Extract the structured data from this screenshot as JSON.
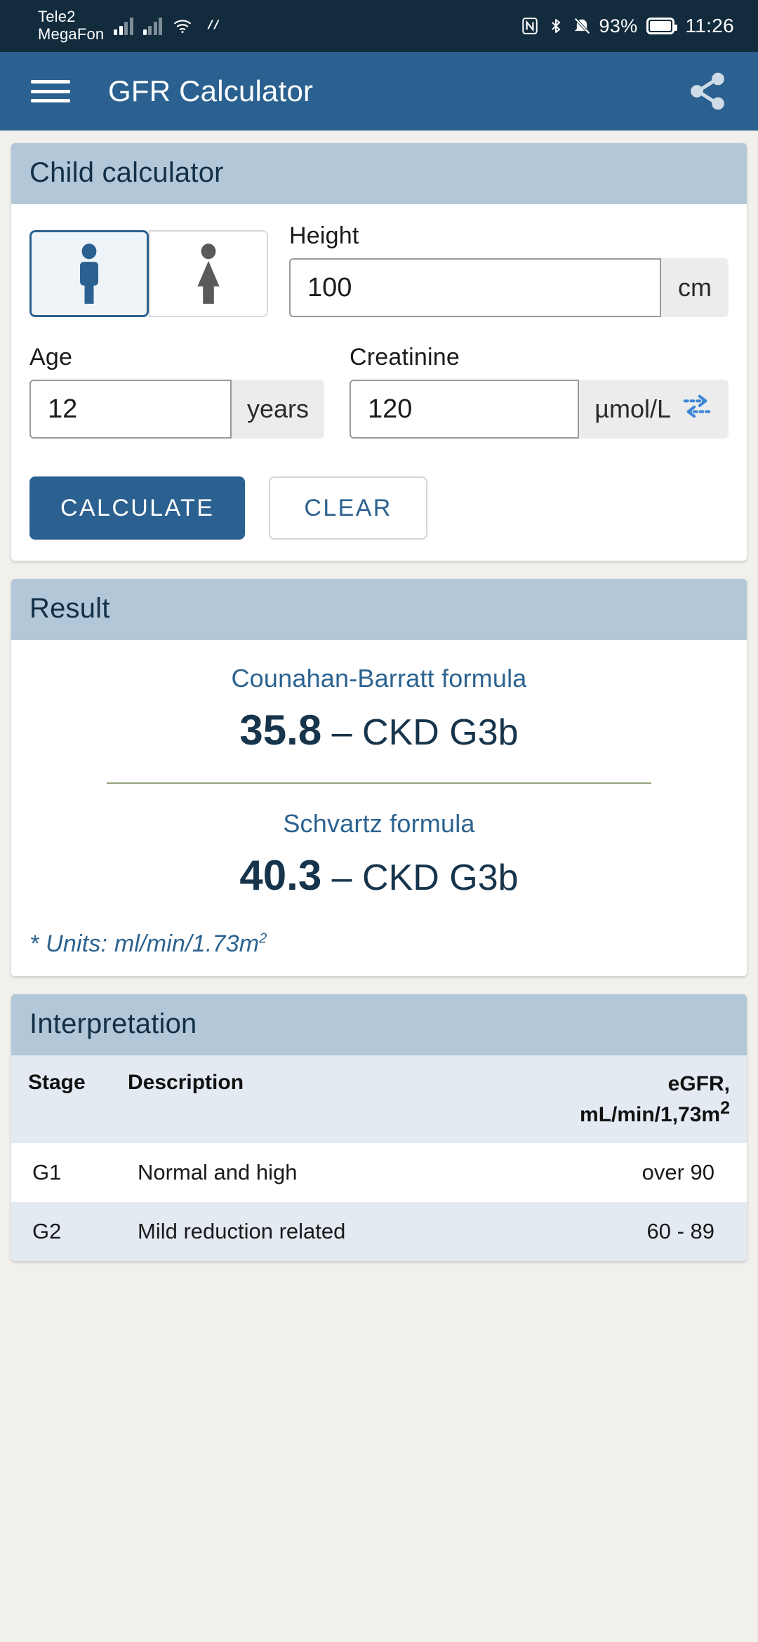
{
  "status_bar": {
    "carrier_1": "Tele2",
    "carrier_2": "MegaFon",
    "battery_percent": "93%",
    "clock": "11:26",
    "icons": [
      "signal-bars-icon",
      "signal-bars-icon",
      "wifi-icon",
      "data-transfer-icon",
      "nfc-icon",
      "bluetooth-icon",
      "mute-icon",
      "battery-icon"
    ]
  },
  "app_bar": {
    "menu_icon": "hamburger-menu-icon",
    "title": "GFR Calculator",
    "share_icon": "share-icon"
  },
  "calculator_card": {
    "title": "Child calculator",
    "gender": {
      "selected": "male",
      "male_label": "male-figure-icon",
      "female_label": "female-figure-icon"
    },
    "height": {
      "label": "Height",
      "value": "100",
      "unit": "cm"
    },
    "age": {
      "label": "Age",
      "value": "12",
      "unit": "years"
    },
    "creatinine": {
      "label": "Creatinine",
      "value": "120",
      "unit": "µmol/L",
      "swap_icon": "swap-units-icon"
    },
    "calculate_label": "CALCULATE",
    "clear_label": "CLEAR"
  },
  "result_card": {
    "title": "Result",
    "formulas": [
      {
        "name": "Counahan-Barratt formula",
        "value": "35.8",
        "separator": "–",
        "stage": "CKD G3b"
      },
      {
        "name": "Schvartz formula",
        "value": "40.3",
        "separator": "–",
        "stage": "CKD G3b"
      }
    ],
    "units_note_text": "* Units: ml/min/1.73m",
    "units_note_sup": "2"
  },
  "interpretation_card": {
    "title": "Interpretation",
    "columns": {
      "stage": "Stage",
      "description": "Description",
      "egfr_line1": "eGFR,",
      "egfr_line2": "mL/min/1,73m",
      "egfr_sup": "2"
    },
    "rows": [
      {
        "stage": "G1",
        "description": "Normal and high",
        "egfr": "over 90"
      },
      {
        "stage": "G2",
        "description": "Mild reduction related",
        "egfr": "60 - 89"
      }
    ]
  },
  "colors": {
    "status_bar": "#122b3d",
    "app_bar": "#2b6190",
    "card_header": "#b2c8d8",
    "accent_blue": "#2c6390",
    "dark_navy": "#16344b",
    "divider_green": "#93a37e",
    "table_header_bg": "#e3eaf2",
    "page_bg": "#f2f0ec"
  }
}
